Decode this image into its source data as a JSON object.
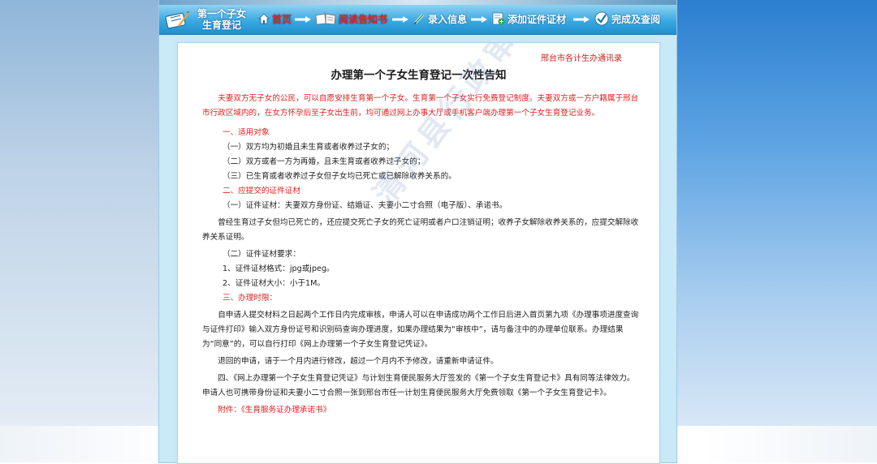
{
  "header": {
    "logo_line1": "第一个子女",
    "logo_line2": "生育登记",
    "nav": [
      {
        "label": "首页",
        "icon": "home-icon",
        "active": true
      },
      {
        "label": "阅读告知书",
        "icon": "book-icon",
        "active": false
      },
      {
        "label": "录入信息",
        "icon": "pen-icon",
        "active": false
      },
      {
        "label": "添加证件证材",
        "icon": "add-document-icon",
        "active": false
      },
      {
        "label": "完成及查阅",
        "icon": "check-icon",
        "active": false
      }
    ]
  },
  "notice": {
    "department": "邢台市各计生办通讯录",
    "title": "办理第一个子女生育登记一次性告知",
    "intro": "夫妻双方无子女的公民，可以自愿安排生育第一个子女。生育第一个子女实行免费登记制度。夫妻双方或一方户籍属于邢台市行政区域内的，在女方怀孕后至子女出生前，均可通过网上办事大厅或手机客户端办理第一个子女生育登记业务。",
    "section1_heading": "一、适用对象",
    "section1_items": [
      "（一）双方均为初婚且未生育或者收养过子女的；",
      "（二）双方或者一方为再婚，且未生育或者收养过子女的；",
      "（三）已生育或者收养过子女但子女均已死亡或已解除收养关系的。"
    ],
    "section2_heading": "二、应提交的证件证材",
    "section2_item1": "（一）证件证材：夫妻双方身份证、结婚证、夫妻小二寸合照（电子版）、承诺书。",
    "section2_note": "曾经生育过子女但均已死亡的，还应提交死亡子女的死亡证明或者户口注销证明；收养子女解除收养关系的，应提交解除收养关系证明。",
    "section2_item2_heading": "（二）证件证材要求：",
    "section2_item2_lines": [
      "1、证件证材格式：jpg或jpeg。",
      "2、证件证材大小：小于1M。"
    ],
    "section3_heading": "三、办理时限：",
    "section3_para1": "自申请人提交材料之日起两个工作日内完成审核，申请人可以在申请成功两个工作日后进入首页第九项《办理事项进度查询与证件打印》输入双方身份证号和识别码查询办理进度，如果办理结果为“审核中”，请与备注中的办理单位联系。办理结果为“同意”的，可以自行打印《网上办理第一个子女生育登记凭证》。",
    "section3_para2": "退回的申请，请于一个月内进行修改，超过一个月内不予修改，请重新申请证件。",
    "section4_para": "四、《网上办理第一个子女生育登记凭证》与计划生育便民服务大厅签发的《第一个子女生育登记卡》具有同等法律效力。申请人也可携带身份证和夫妻小二寸合照一张到邢台市任一计划生育便民服务大厅免费领取《第一个子女生育登记卡》。",
    "attachment": "附件：《生育服务证办理承诺书》",
    "watermark": "清河县行政审批局"
  },
  "colors": {
    "accent_red": "#e02020",
    "nav_blue": "#2b9ed9",
    "frame_bg": "#c9e9f7"
  }
}
